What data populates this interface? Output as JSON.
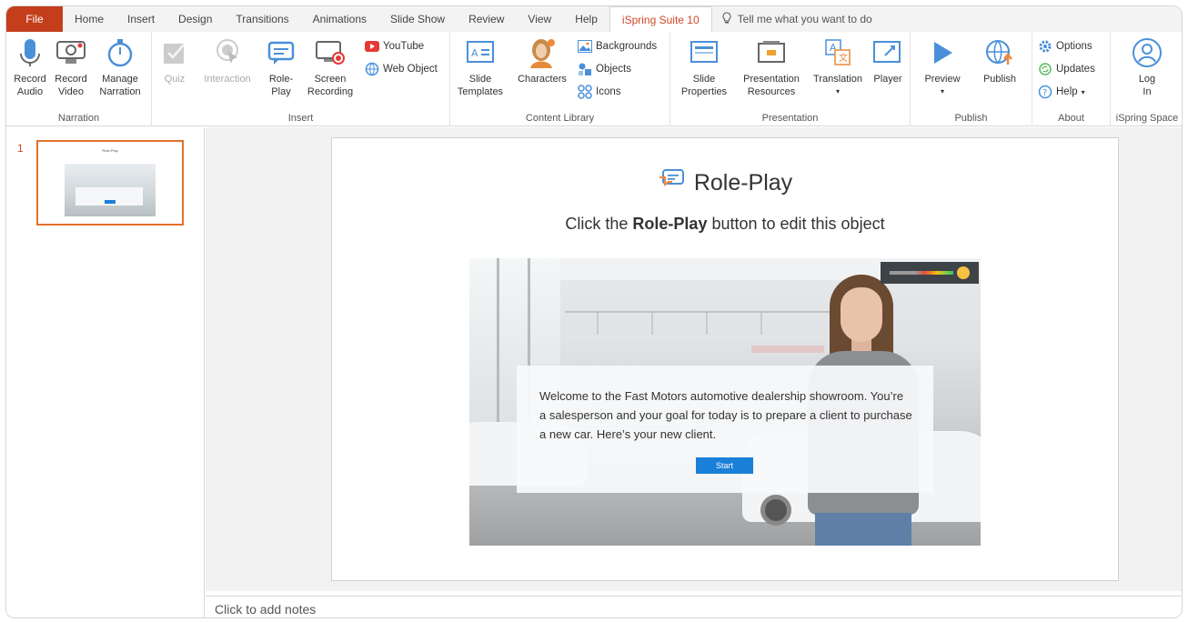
{
  "tabs": [
    {
      "label": "File"
    },
    {
      "label": "Home"
    },
    {
      "label": "Insert"
    },
    {
      "label": "Design"
    },
    {
      "label": "Transitions"
    },
    {
      "label": "Animations"
    },
    {
      "label": "Slide Show"
    },
    {
      "label": "Review"
    },
    {
      "label": "View"
    },
    {
      "label": "Help"
    },
    {
      "label": "iSpring Suite 10"
    }
  ],
  "tell_me": "Tell me what you want to do",
  "ribbon": {
    "narration": {
      "label": "Narration",
      "record_audio": [
        "Record",
        "Audio"
      ],
      "record_video": [
        "Record",
        "Video"
      ],
      "manage_narration": [
        "Manage",
        "Narration"
      ]
    },
    "insert": {
      "label": "Insert",
      "quiz": "Quiz",
      "interaction": "Interaction",
      "role_play": [
        "Role-",
        "Play"
      ],
      "screen_recording": [
        "Screen",
        "Recording"
      ],
      "youtube": "YouTube",
      "web_object": "Web Object"
    },
    "content_library": {
      "label": "Content Library",
      "slide_templates": [
        "Slide",
        "Templates"
      ],
      "characters": "Characters",
      "backgrounds": "Backgrounds",
      "objects": "Objects",
      "icons": "Icons"
    },
    "presentation": {
      "label": "Presentation",
      "slide_properties": [
        "Slide",
        "Properties"
      ],
      "presentation_resources": [
        "Presentation",
        "Resources"
      ],
      "translation": "Translation",
      "player": "Player"
    },
    "publish": {
      "label": "Publish",
      "preview": "Preview",
      "publish": "Publish"
    },
    "about": {
      "label": "About",
      "options": "Options",
      "updates": "Updates",
      "help": "Help"
    },
    "ispring_space": {
      "label": "iSpring Space",
      "log_in": [
        "Log",
        "In"
      ]
    }
  },
  "slides_panel": {
    "slide_number": "1"
  },
  "slide": {
    "title": "Role-Play",
    "subtitle_prefix": "Click the ",
    "subtitle_bold": "Role-Play",
    "subtitle_suffix": " button to edit this object",
    "dialog_text": "Welcome to the Fast Motors automotive dealership showroom. You’re a salesperson and your goal for today is to prepare a client to purchase a new car. Here’s your new client.",
    "start_button": "Start"
  },
  "notes_placeholder": "Click to add notes",
  "colors": {
    "file_tab": "#c43e1c",
    "active_tab_text": "#d24726",
    "selection_border": "#e3702d",
    "icon_blue": "#1a7fd8"
  }
}
